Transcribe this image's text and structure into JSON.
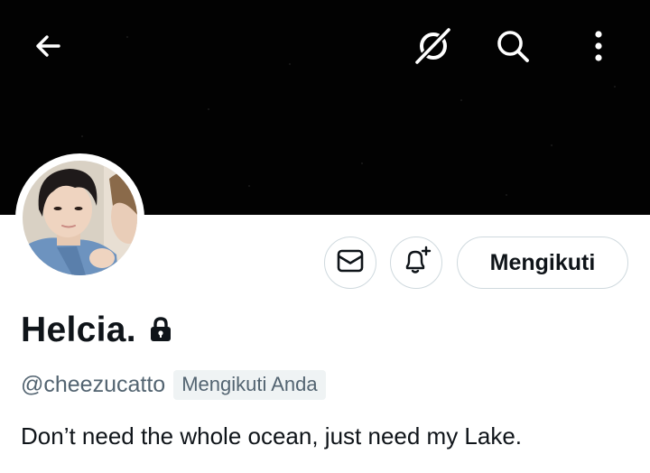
{
  "header": {
    "back_icon": "arrow-left-icon",
    "grok_icon": "grok-icon",
    "search_icon": "search-icon",
    "more_icon": "more-vertical-icon",
    "banner_color": "#020202"
  },
  "profile": {
    "avatar": "avatar-photo",
    "display_name": "Helcia.",
    "protected_icon": "lock-icon",
    "handle": "@cheezucatto",
    "follows_you_badge": "Mengikuti Anda",
    "bio": "Don’t need the whole ocean, just need my Lake."
  },
  "actions": {
    "message_icon": "envelope-icon",
    "notify_icon": "bell-plus-icon",
    "follow_label": "Mengikuti"
  },
  "colors": {
    "text_primary": "#0f1419",
    "text_secondary": "#536471",
    "border": "#cfd9de",
    "badge_bg": "#eff3f4"
  }
}
